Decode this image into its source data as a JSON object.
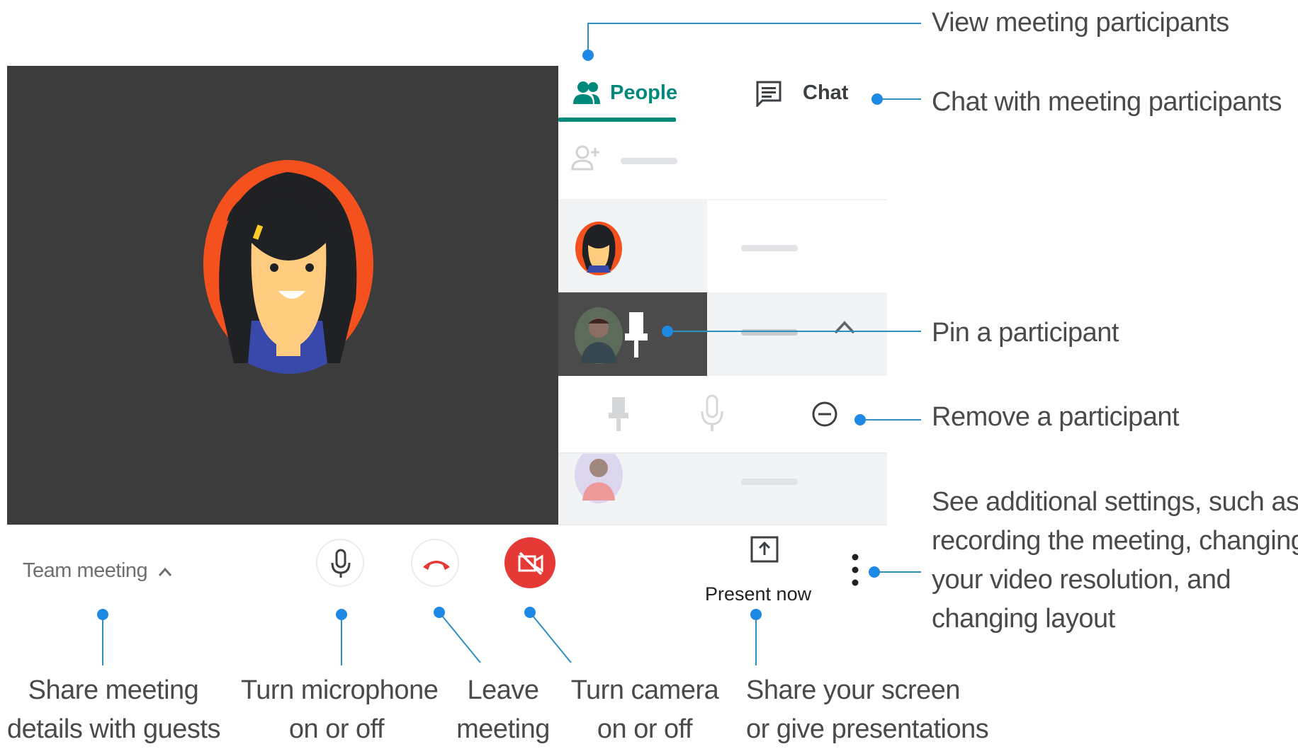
{
  "panel": {
    "tabs": [
      {
        "label": "People",
        "icon": "people-icon",
        "active": true
      },
      {
        "label": "Chat",
        "icon": "chat-icon",
        "active": false
      }
    ]
  },
  "toolbar": {
    "meeting_title": "Team meeting",
    "present_label": "Present now"
  },
  "annotations": {
    "view_participants": "View meeting participants",
    "chat_participants": "Chat with meeting participants",
    "pin_participant": "Pin a participant",
    "remove_participant": "Remove a participant",
    "additional_settings": [
      "See additional settings, such as",
      "recording the meeting, changing",
      "your video resolution, and",
      "changing layout"
    ],
    "share_details": [
      "Share meeting",
      "details with guests"
    ],
    "toggle_mic": [
      "Turn microphone",
      "on or off"
    ],
    "leave_meeting": [
      "Leave",
      "meeting"
    ],
    "toggle_camera": [
      "Turn camera",
      "on or off"
    ],
    "share_screen": [
      "Share your screen",
      "or give presentations"
    ]
  },
  "colors": {
    "accent_teal": "#00897b",
    "callout_blue": "#1e88e5",
    "leave_red": "#e53935",
    "video_bg": "#3c3c3c",
    "avatar_orange": "#f4511e"
  }
}
